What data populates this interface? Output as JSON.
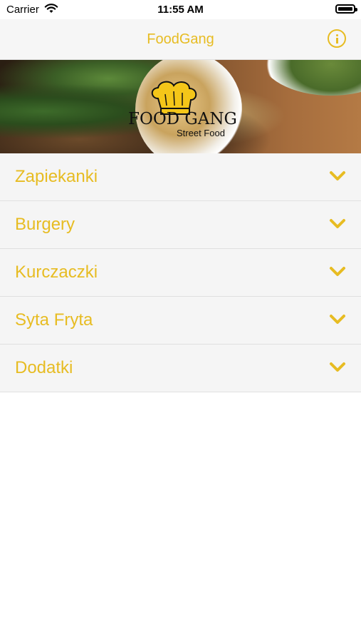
{
  "status_bar": {
    "carrier": "Carrier",
    "time": "11:55 AM"
  },
  "nav": {
    "title": "FoodGang"
  },
  "banner": {
    "logo_text_line1": "FOOD GANG",
    "logo_text_line2": "Street Food"
  },
  "menu": {
    "items": [
      {
        "label": "Zapiekanki"
      },
      {
        "label": "Burgery"
      },
      {
        "label": "Kurczaczki"
      },
      {
        "label": "Syta Fryta"
      },
      {
        "label": "Dodatki"
      }
    ]
  },
  "colors": {
    "accent": "#e7bc22",
    "row_background": "#f5f5f5"
  }
}
